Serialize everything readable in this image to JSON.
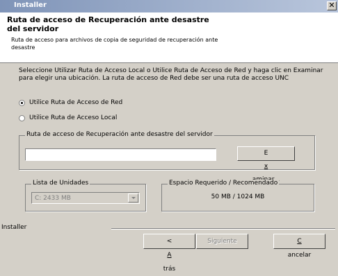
{
  "window": {
    "title": "Installer",
    "close_glyph": "✕"
  },
  "header": {
    "title": "Ruta de acceso de Recuperación ante desastre del servidor",
    "subtitle": "Ruta de acceso para archivos de copia de seguridad de recuperación ante desastre"
  },
  "instructions": "Seleccione Utilizar Ruta de Acceso Local o Utilice Ruta de Acceso de Red y haga clic en Examinar para elegir una ubicación. La ruta de acceso de Red debe ser una ruta de acceso UNC",
  "options": {
    "network": {
      "label": "Utilice Ruta de Acceso de Red",
      "selected": true
    },
    "local": {
      "label": "Utilice Ruta de Acceso Local",
      "selected": false
    }
  },
  "path_group": {
    "legend": "Ruta de acceso de Recuperación ante desastre del servidor",
    "value": "",
    "browse_pre": "E",
    "browse_u": "x",
    "browse_post": "aminar..."
  },
  "drives": {
    "legend": "Lista de Unidades",
    "selected": "C:  2433 MB"
  },
  "space": {
    "legend": "Espacio Requerido / Recomendado",
    "value": "50 MB / 1024 MB"
  },
  "footer": {
    "label": "Installer",
    "back_pre": "< ",
    "back_u": "A",
    "back_post": "trás",
    "next": "Siguiente",
    "cancel_u": "C",
    "cancel_post": "ancelar"
  }
}
